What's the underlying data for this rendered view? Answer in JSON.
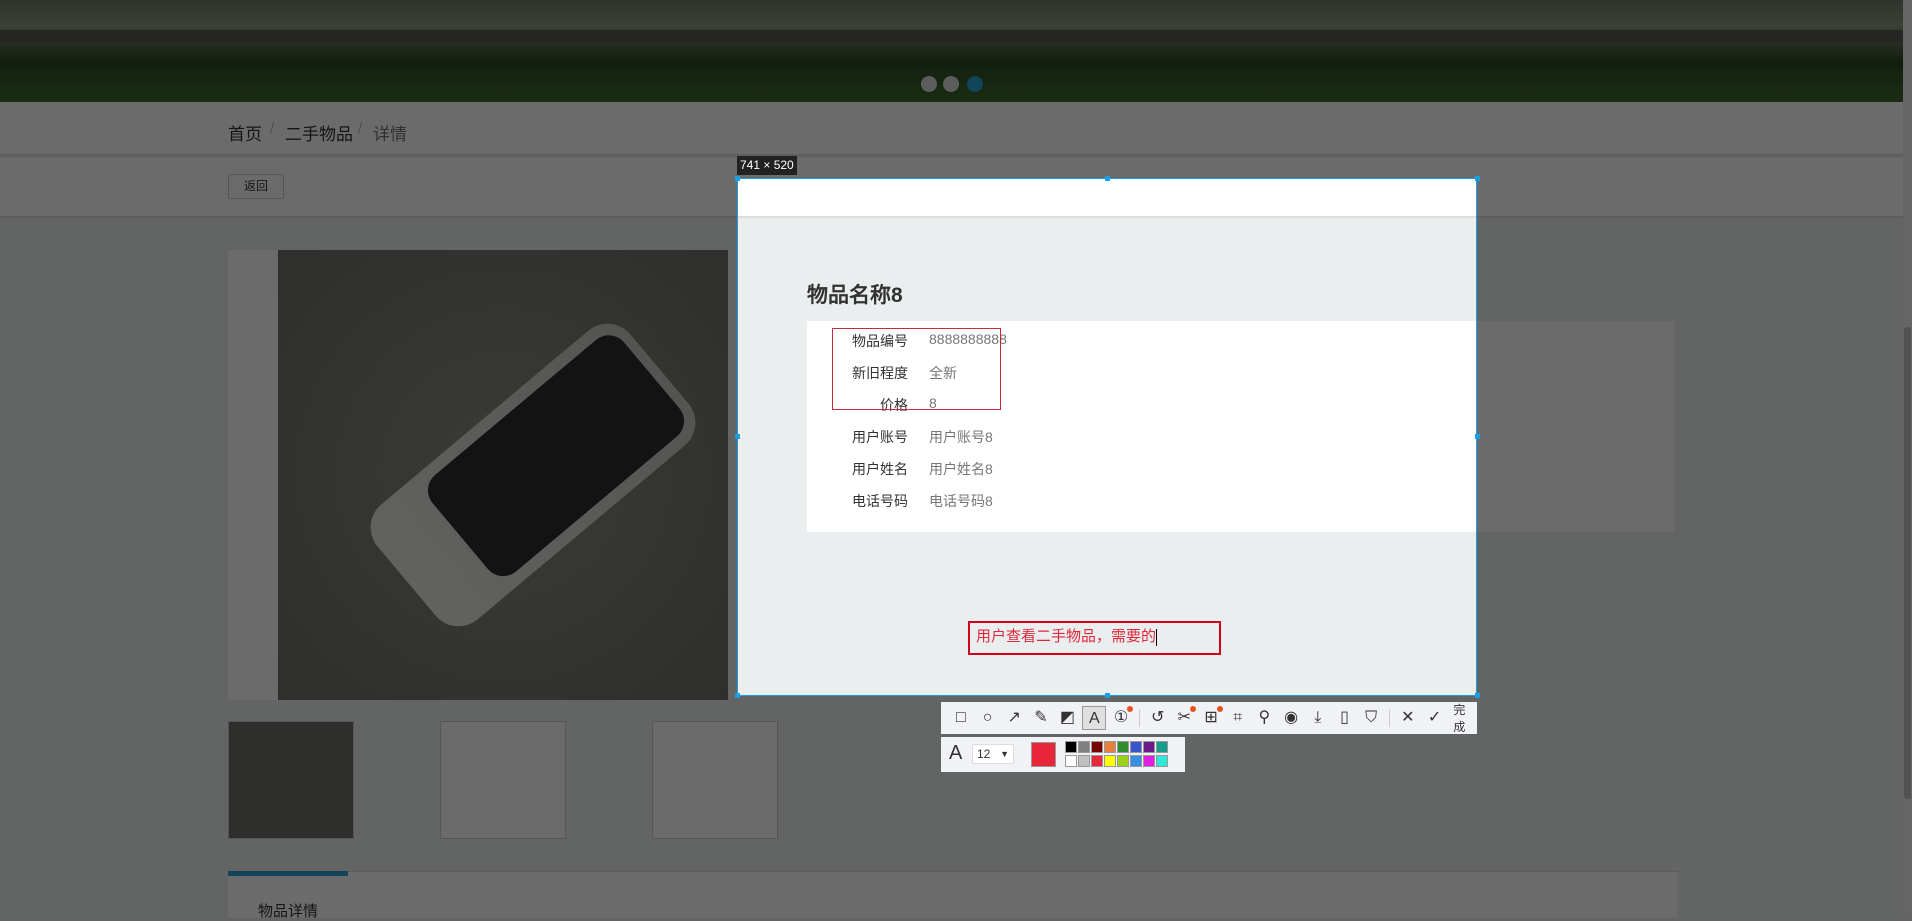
{
  "breadcrumb": [
    "首页",
    "二手物品",
    "详情"
  ],
  "breadcrumb_sep": "/",
  "back_label": "返回",
  "carousel": {
    "count": 3,
    "active": 2
  },
  "item": {
    "title": "物品名称8",
    "fields": [
      {
        "label": "物品编号",
        "value": "8888888888"
      },
      {
        "label": "新旧程度",
        "value": "全新"
      },
      {
        "label": "价格",
        "value": "8"
      },
      {
        "label": "用户账号",
        "value": "用户账号8"
      },
      {
        "label": "用户姓名",
        "value": "用户姓名8"
      },
      {
        "label": "电话号码",
        "value": "电话号码8"
      }
    ]
  },
  "tab_label": "物品详情",
  "screenshot_tool": {
    "size_label": "741 × 520",
    "annotation_text": "用户查看二手物品，需要的",
    "done_label": "完成",
    "font_size": "12",
    "current_color": "#e8283a",
    "tools": [
      "rectangle-icon",
      "ellipse-icon",
      "arrow-icon",
      "pencil-icon",
      "mosaic-icon",
      "text-icon",
      "number-icon",
      "undo-icon",
      "cut-icon",
      "translate-icon",
      "ocr-icon",
      "pin-icon",
      "record-icon",
      "download-icon",
      "long-screenshot-icon",
      "bookmark-icon",
      "close-icon",
      "check-icon"
    ],
    "palette": [
      "#000000",
      "#808080",
      "#7a0000",
      "#e6803a",
      "#2e8b2e",
      "#3a55d0",
      "#6a1a8a",
      "#169c8c",
      "#ffffff",
      "#c0c0c0",
      "#e8283a",
      "#ffff00",
      "#9ad11a",
      "#3a90e0",
      "#e020e0",
      "#30e8d8"
    ]
  }
}
